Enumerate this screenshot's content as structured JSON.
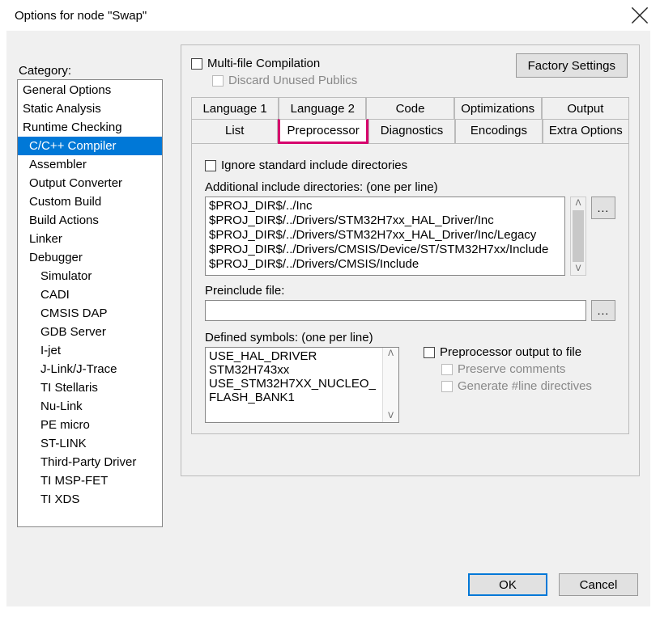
{
  "title": "Options for node \"Swap\"",
  "category_label": "Category:",
  "categories": [
    {
      "label": "General Options",
      "indent": false,
      "selected": false
    },
    {
      "label": "Static Analysis",
      "indent": false,
      "selected": false
    },
    {
      "label": "Runtime Checking",
      "indent": false,
      "selected": false
    },
    {
      "label": "C/C++ Compiler",
      "indent": true,
      "selected": true
    },
    {
      "label": "Assembler",
      "indent": true,
      "selected": false
    },
    {
      "label": "Output Converter",
      "indent": true,
      "selected": false
    },
    {
      "label": "Custom Build",
      "indent": true,
      "selected": false
    },
    {
      "label": "Build Actions",
      "indent": true,
      "selected": false
    },
    {
      "label": "Linker",
      "indent": true,
      "selected": false
    },
    {
      "label": "Debugger",
      "indent": true,
      "selected": false
    },
    {
      "label": "Simulator",
      "indent": true,
      "selected": false,
      "sub": true
    },
    {
      "label": "CADI",
      "indent": true,
      "selected": false,
      "sub": true
    },
    {
      "label": "CMSIS DAP",
      "indent": true,
      "selected": false,
      "sub": true
    },
    {
      "label": "GDB Server",
      "indent": true,
      "selected": false,
      "sub": true
    },
    {
      "label": "I-jet",
      "indent": true,
      "selected": false,
      "sub": true
    },
    {
      "label": "J-Link/J-Trace",
      "indent": true,
      "selected": false,
      "sub": true
    },
    {
      "label": "TI Stellaris",
      "indent": true,
      "selected": false,
      "sub": true
    },
    {
      "label": "Nu-Link",
      "indent": true,
      "selected": false,
      "sub": true
    },
    {
      "label": "PE micro",
      "indent": true,
      "selected": false,
      "sub": true
    },
    {
      "label": "ST-LINK",
      "indent": true,
      "selected": false,
      "sub": true
    },
    {
      "label": "Third-Party Driver",
      "indent": true,
      "selected": false,
      "sub": true
    },
    {
      "label": "TI MSP-FET",
      "indent": true,
      "selected": false,
      "sub": true
    },
    {
      "label": "TI XDS",
      "indent": true,
      "selected": false,
      "sub": true
    }
  ],
  "factory_settings": "Factory Settings",
  "multi_file": "Multi-file Compilation",
  "discard_unused": "Discard Unused Publics",
  "tabs_top": [
    "Language 1",
    "Language 2",
    "Code",
    "Optimizations",
    "Output"
  ],
  "tabs_bottom": [
    "List",
    "Preprocessor",
    "Diagnostics",
    "Encodings",
    "Extra Options"
  ],
  "active_tab": "Preprocessor",
  "ignore_std": "Ignore standard include directories",
  "addl_include_label": "Additional include directories: (one per line)",
  "addl_include": [
    "$PROJ_DIR$/../Inc",
    "$PROJ_DIR$/../Drivers/STM32H7xx_HAL_Driver/Inc",
    "$PROJ_DIR$/../Drivers/STM32H7xx_HAL_Driver/Inc/Legacy",
    "$PROJ_DIR$/../Drivers/CMSIS/Device/ST/STM32H7xx/Include",
    "$PROJ_DIR$/../Drivers/CMSIS/Include"
  ],
  "preinclude_label": "Preinclude file:",
  "preinclude_value": "",
  "defined_label": "Defined symbols: (one per line)",
  "defined_symbols": [
    "USE_HAL_DRIVER",
    "STM32H743xx",
    "USE_STM32H7XX_NUCLEO_",
    "FLASH_BANK1"
  ],
  "defined_selected_index": 3,
  "preproc_output": "Preprocessor output to file",
  "preserve_comments": "Preserve comments",
  "gen_line": "Generate #line directives",
  "browse_btn": "...",
  "ok": "OK",
  "cancel": "Cancel"
}
